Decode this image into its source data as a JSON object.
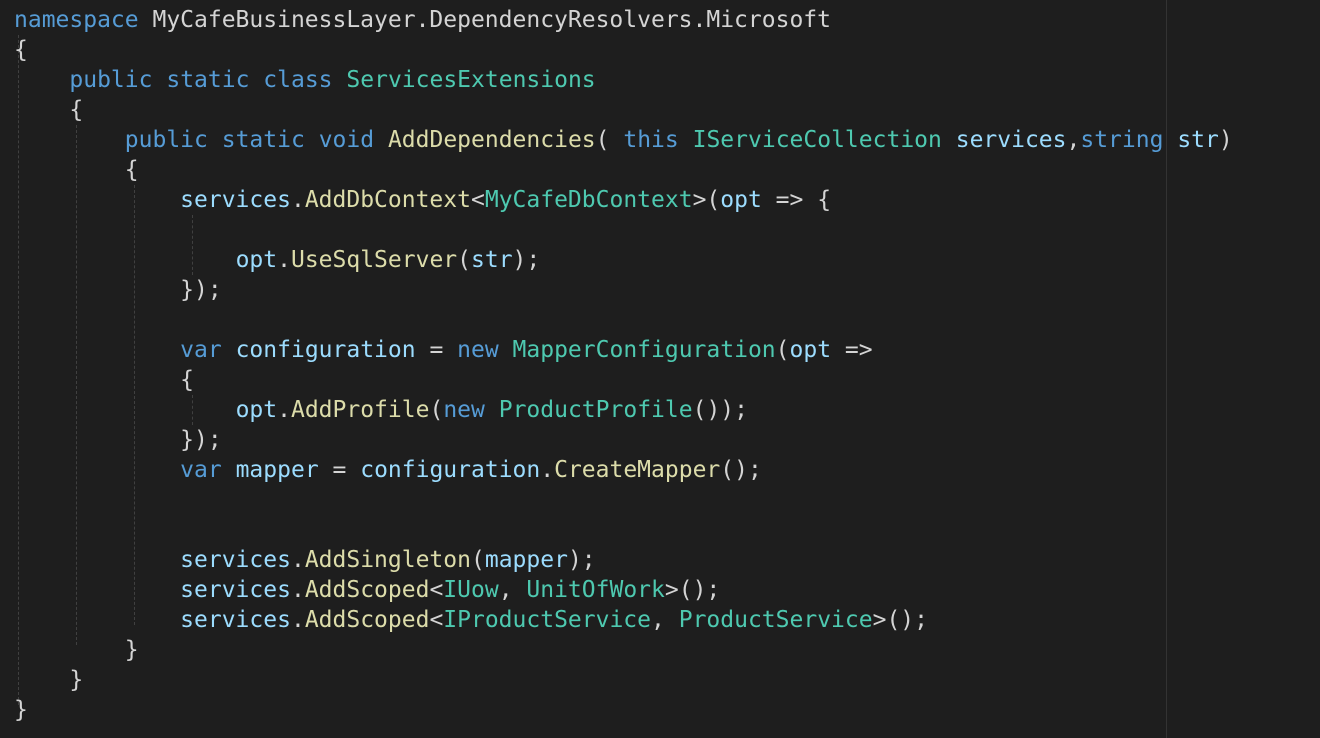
{
  "editor": {
    "theme_colors": {
      "background": "#1e1e1e",
      "keyword": "#569cd6",
      "type": "#4ec9b0",
      "function": "#dcdcaa",
      "variable": "#9cdcfe",
      "plain": "#d4d4d4"
    },
    "lines": [
      [
        [
          "kw",
          "namespace"
        ],
        [
          "pn",
          " MyCafeBusinessLayer.DependencyResolvers.Microsoft"
        ]
      ],
      [
        [
          "pn",
          "{"
        ]
      ],
      [
        [
          "pn",
          "    "
        ],
        [
          "kw",
          "public"
        ],
        [
          "pn",
          " "
        ],
        [
          "kw",
          "static"
        ],
        [
          "pn",
          " "
        ],
        [
          "kw",
          "class"
        ],
        [
          "pn",
          " "
        ],
        [
          "typ",
          "ServicesExtensions"
        ]
      ],
      [
        [
          "pn",
          "    {"
        ]
      ],
      [
        [
          "pn",
          "        "
        ],
        [
          "kw",
          "public"
        ],
        [
          "pn",
          " "
        ],
        [
          "kw",
          "static"
        ],
        [
          "pn",
          " "
        ],
        [
          "kw",
          "void"
        ],
        [
          "pn",
          " "
        ],
        [
          "fn",
          "AddDependencies"
        ],
        [
          "pn",
          "( "
        ],
        [
          "kw",
          "this"
        ],
        [
          "pn",
          " "
        ],
        [
          "typ",
          "IServiceCollection"
        ],
        [
          "pn",
          " "
        ],
        [
          "var",
          "services"
        ],
        [
          "pn",
          ","
        ],
        [
          "kw",
          "string"
        ],
        [
          "pn",
          " "
        ],
        [
          "var",
          "str"
        ],
        [
          "pn",
          ")"
        ]
      ],
      [
        [
          "pn",
          "        {"
        ]
      ],
      [
        [
          "pn",
          "            "
        ],
        [
          "var",
          "services"
        ],
        [
          "pn",
          "."
        ],
        [
          "fn",
          "AddDbContext"
        ],
        [
          "pn",
          "<"
        ],
        [
          "typ",
          "MyCafeDbContext"
        ],
        [
          "pn",
          ">("
        ],
        [
          "var",
          "opt"
        ],
        [
          "pn",
          " => {"
        ]
      ],
      [],
      [
        [
          "pn",
          "                "
        ],
        [
          "var",
          "opt"
        ],
        [
          "pn",
          "."
        ],
        [
          "fn",
          "UseSqlServer"
        ],
        [
          "pn",
          "("
        ],
        [
          "var",
          "str"
        ],
        [
          "pn",
          ");"
        ]
      ],
      [
        [
          "pn",
          "            });"
        ]
      ],
      [],
      [
        [
          "pn",
          "            "
        ],
        [
          "kw",
          "var"
        ],
        [
          "pn",
          " "
        ],
        [
          "var",
          "configuration"
        ],
        [
          "pn",
          " = "
        ],
        [
          "kw",
          "new"
        ],
        [
          "pn",
          " "
        ],
        [
          "typ",
          "MapperConfiguration"
        ],
        [
          "pn",
          "("
        ],
        [
          "var",
          "opt"
        ],
        [
          "pn",
          " =>"
        ]
      ],
      [
        [
          "pn",
          "            {"
        ]
      ],
      [
        [
          "pn",
          "                "
        ],
        [
          "var",
          "opt"
        ],
        [
          "pn",
          "."
        ],
        [
          "fn",
          "AddProfile"
        ],
        [
          "pn",
          "("
        ],
        [
          "kw",
          "new"
        ],
        [
          "pn",
          " "
        ],
        [
          "typ",
          "ProductProfile"
        ],
        [
          "pn",
          "());"
        ]
      ],
      [
        [
          "pn",
          "            });"
        ]
      ],
      [
        [
          "pn",
          "            "
        ],
        [
          "kw",
          "var"
        ],
        [
          "pn",
          " "
        ],
        [
          "var",
          "mapper"
        ],
        [
          "pn",
          " = "
        ],
        [
          "var",
          "configuration"
        ],
        [
          "pn",
          "."
        ],
        [
          "fn",
          "CreateMapper"
        ],
        [
          "pn",
          "();"
        ]
      ],
      [],
      [],
      [
        [
          "pn",
          "            "
        ],
        [
          "var",
          "services"
        ],
        [
          "pn",
          "."
        ],
        [
          "fn",
          "AddSingleton"
        ],
        [
          "pn",
          "("
        ],
        [
          "var",
          "mapper"
        ],
        [
          "pn",
          ");"
        ]
      ],
      [
        [
          "pn",
          "            "
        ],
        [
          "var",
          "services"
        ],
        [
          "pn",
          "."
        ],
        [
          "fn",
          "AddScoped"
        ],
        [
          "pn",
          "<"
        ],
        [
          "typ",
          "IUow"
        ],
        [
          "pn",
          ", "
        ],
        [
          "typ",
          "UnitOfWork"
        ],
        [
          "pn",
          ">();"
        ]
      ],
      [
        [
          "pn",
          "            "
        ],
        [
          "var",
          "services"
        ],
        [
          "pn",
          "."
        ],
        [
          "fn",
          "AddScoped"
        ],
        [
          "pn",
          "<"
        ],
        [
          "typ",
          "IProductService"
        ],
        [
          "pn",
          ", "
        ],
        [
          "typ",
          "ProductService"
        ],
        [
          "pn",
          ">();"
        ]
      ],
      [
        [
          "pn",
          "        }"
        ]
      ],
      [
        [
          "pn",
          "    }"
        ]
      ],
      [
        [
          "pn",
          "}"
        ]
      ]
    ]
  }
}
